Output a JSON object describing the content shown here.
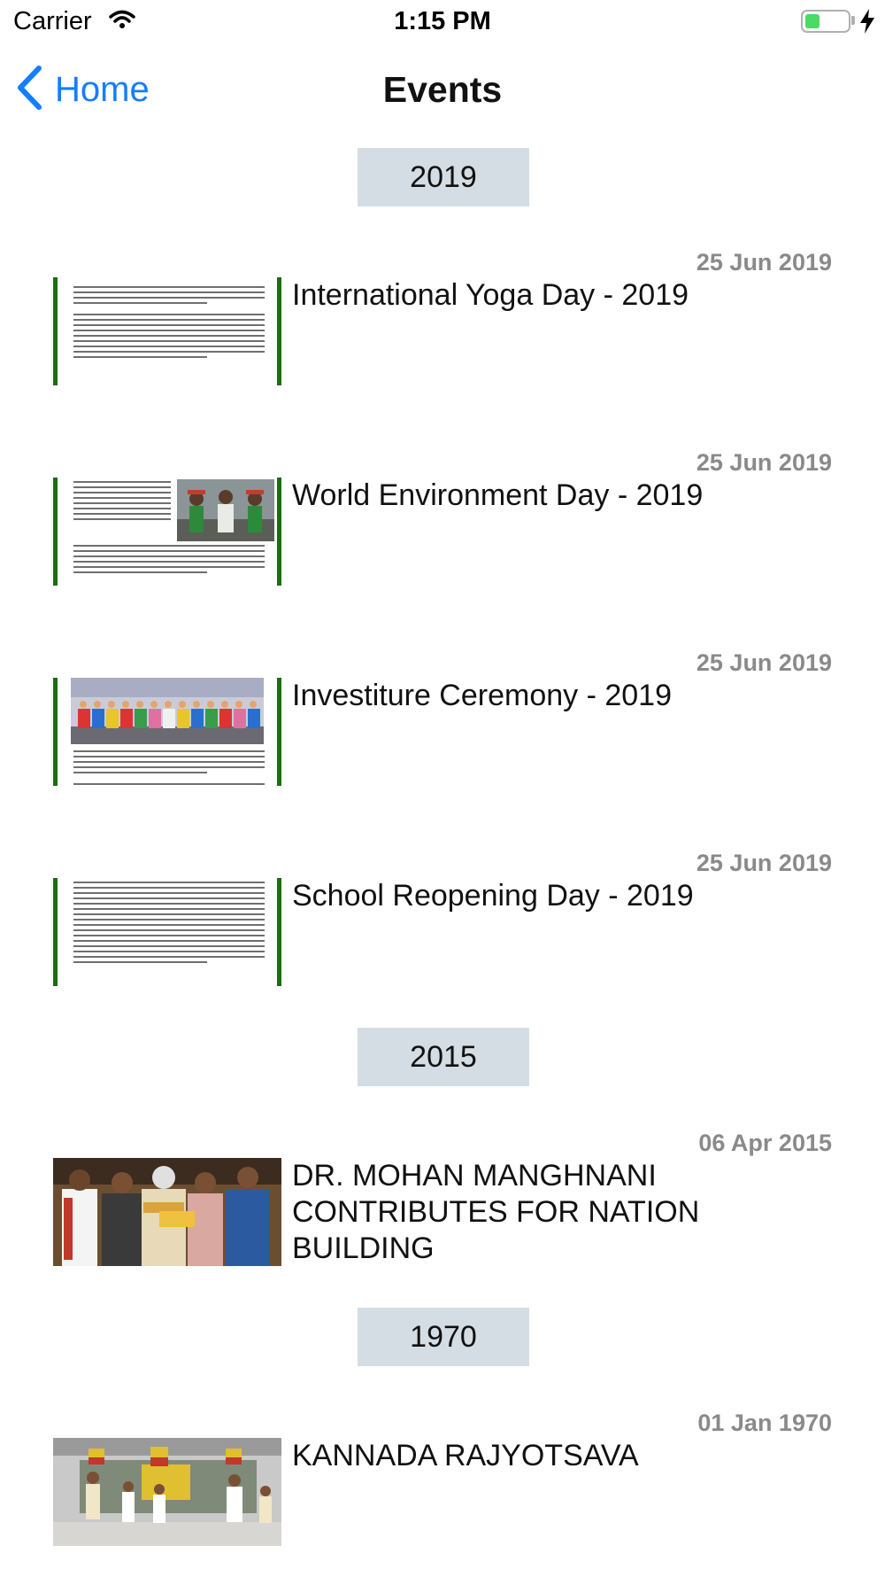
{
  "status_bar": {
    "carrier": "Carrier",
    "time": "1:15 PM",
    "battery_level": 0.35
  },
  "nav": {
    "back_label": "Home",
    "title": "Events"
  },
  "sections": [
    {
      "year": "2019",
      "events": [
        {
          "date": "25 Jun 2019",
          "title": "International Yoga Day - 2019",
          "thumbnail": "document-image"
        },
        {
          "date": "25 Jun 2019",
          "title": "World Environment Day - 2019",
          "thumbnail": "document-with-photo"
        },
        {
          "date": "25 Jun 2019",
          "title": "Investiture Ceremony - 2019",
          "thumbnail": "group-photo-document"
        },
        {
          "date": "25 Jun 2019",
          "title": "School Reopening Day - 2019",
          "thumbnail": "document-image"
        }
      ]
    },
    {
      "year": "2015",
      "events": [
        {
          "date": "06 Apr 2015",
          "title": "DR. MOHAN MANGHNANI CONTRIBUTES FOR NATION BUILDING",
          "thumbnail": "award-photo"
        }
      ]
    },
    {
      "year": "1970",
      "events": [
        {
          "date": "01 Jan 1970",
          "title": "KANNADA RAJYOTSAVA",
          "thumbnail": "dance-performance-photo"
        }
      ]
    }
  ],
  "colors": {
    "accent": "#147efb",
    "year_header_bg": "#d5dde4",
    "date_text": "#8a8a8a",
    "thumb_border": "#1e6b13"
  }
}
